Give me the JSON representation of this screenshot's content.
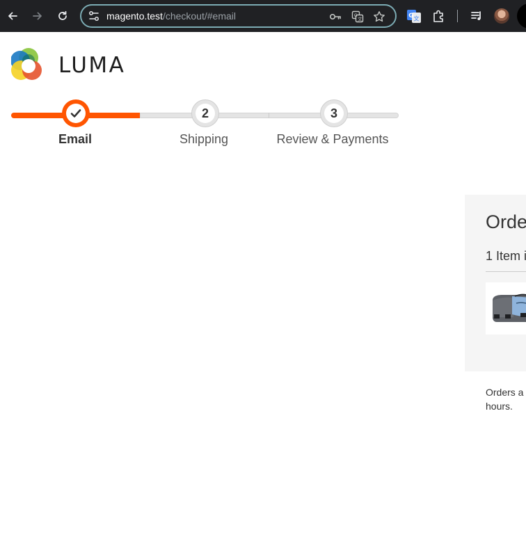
{
  "browser": {
    "url_host": "magento.test",
    "url_path": "/checkout/#email",
    "icons": {
      "back": "arrow-left-icon",
      "forward": "arrow-right-icon",
      "reload": "reload-icon",
      "site_settings": "tune-icon",
      "passwords": "key-icon",
      "translate": "translate-icon",
      "bookmark": "star-icon",
      "extension_google_translate": "google-translate-icon",
      "extensions": "puzzle-icon",
      "media": "media-queue-icon",
      "profile": "avatar"
    }
  },
  "brand": {
    "name": "LUMA",
    "colors": {
      "accent": "#ff5501",
      "logo_blue": "#1979c3",
      "logo_green": "#8bc53f",
      "logo_yellow": "#f5d328",
      "logo_orange": "#e5532d"
    }
  },
  "progress": {
    "current_step": 1,
    "steps": [
      {
        "label": "Email",
        "number": "1",
        "status": "complete"
      },
      {
        "label": "Shipping",
        "number": "2",
        "status": "pending"
      },
      {
        "label": "Review & Payments",
        "number": "3",
        "status": "pending"
      }
    ]
  },
  "order_summary": {
    "title": "Orde",
    "items_count": "1 Item i",
    "product_image": "messenger-bag-image",
    "note_line1": "Orders a",
    "note_line2": "hours."
  }
}
